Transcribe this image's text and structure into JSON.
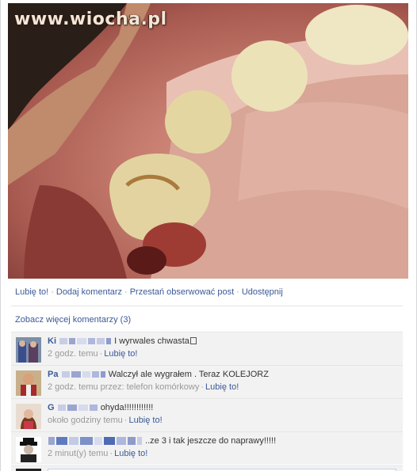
{
  "photo": {
    "watermark": "www.wiocha.pl"
  },
  "actions": {
    "like": "Lubię to!",
    "comment": "Dodaj komentarz",
    "unfollow": "Przestań obserwować post",
    "share": "Udostępnij",
    "separator": "·"
  },
  "more_comments": "Zobacz więcej komentarzy (3)",
  "comments": [
    {
      "name": "Ki",
      "text": "I wyrwales chwasta",
      "time": "2 godz. temu",
      "like": "Lubię to!"
    },
    {
      "name": "Pa",
      "text": "Walczył ale wygrałem . Teraz KOLEJORZ",
      "time": "2 godz. temu przez: telefon komórkowy",
      "like": "Lubię to!"
    },
    {
      "name": "G",
      "text": "ohyda!!!!!!!!!!!!",
      "time": "około godziny temu",
      "like": "Lubię to!"
    },
    {
      "name": "",
      "text": "..ze 3 i tak jeszcze do naprawy!!!!!",
      "time": "2 minut(y) temu",
      "like": "Lubię to!"
    }
  ],
  "colors": {
    "link": "#3b5998",
    "meta": "#999999",
    "comment_bg": "#f2f2f2"
  }
}
